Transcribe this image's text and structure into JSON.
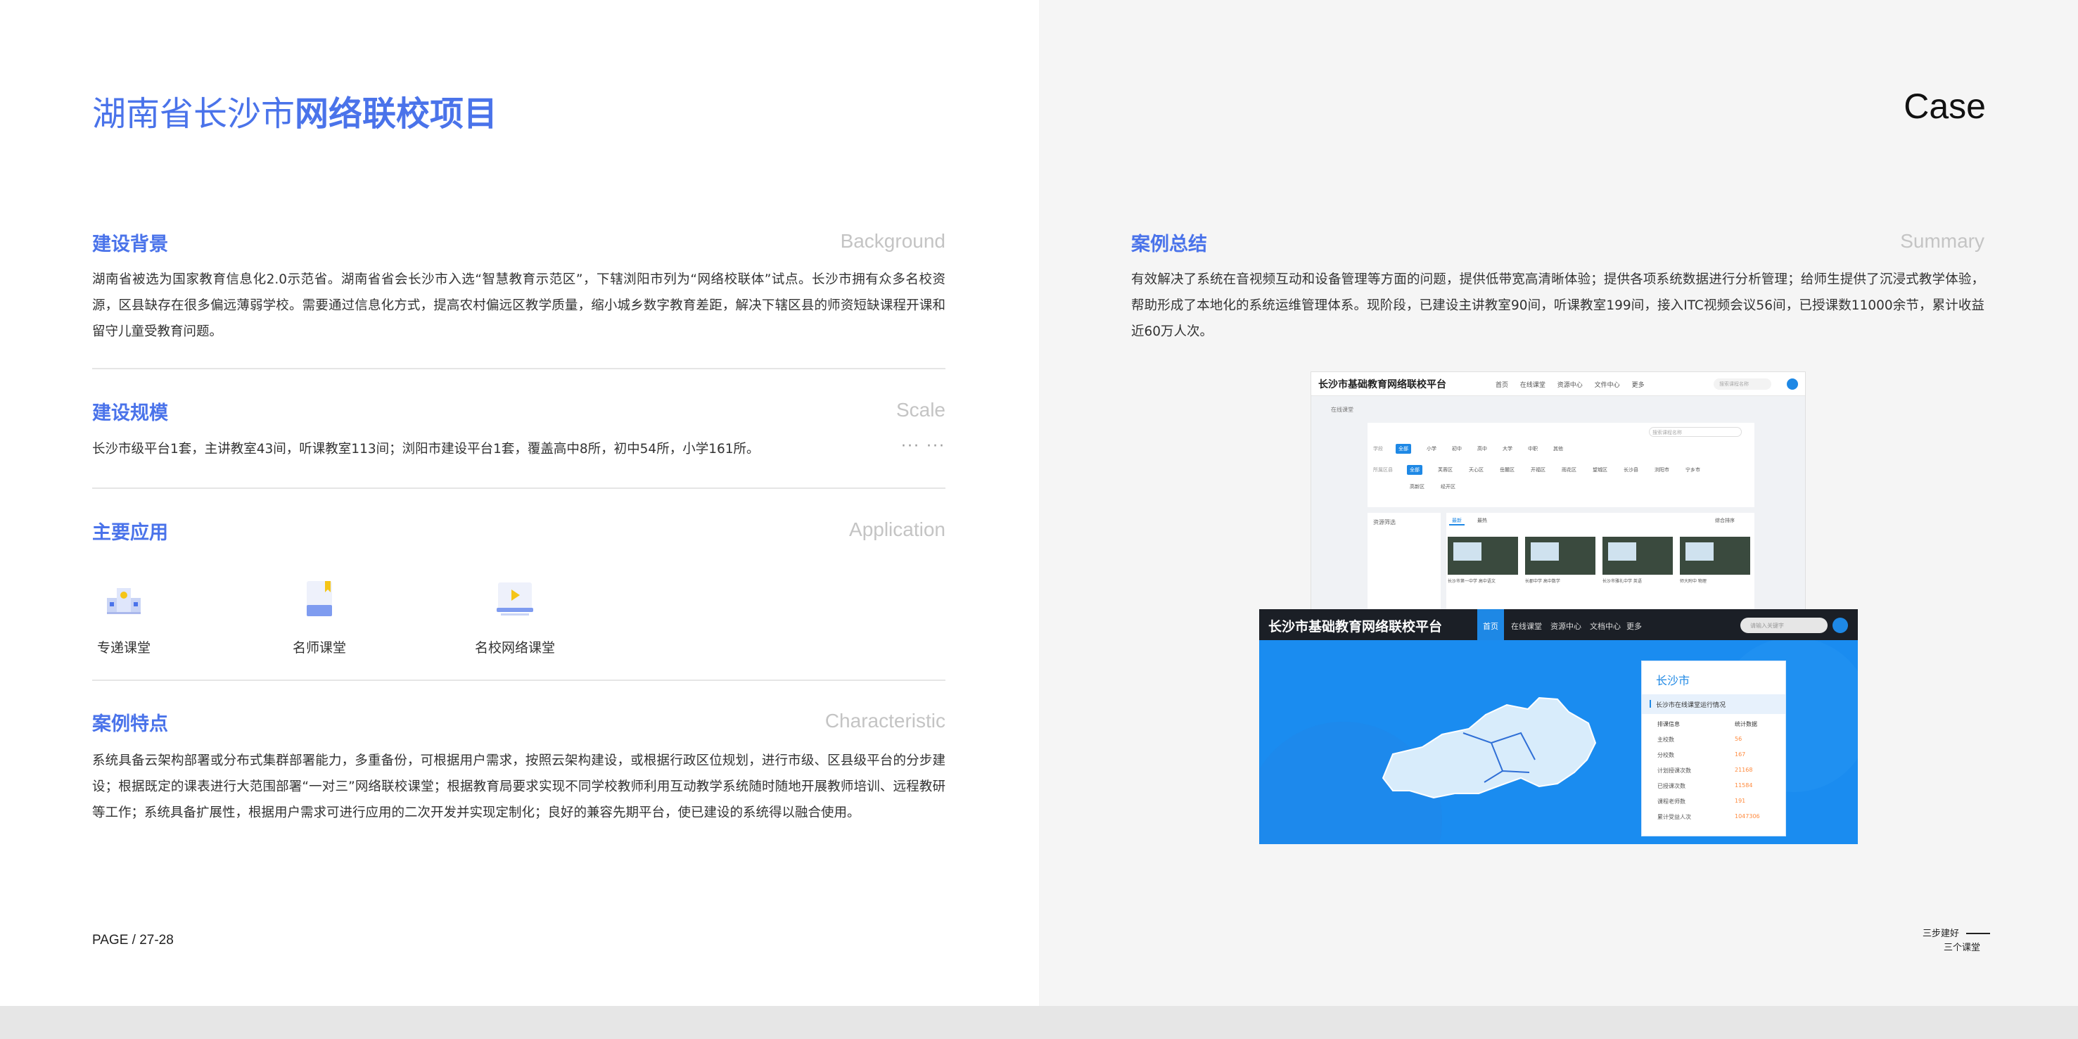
{
  "header": {
    "title_light": "湖南省长沙市",
    "title_bold": "网络联校项目",
    "case_label": "Case"
  },
  "sections": {
    "background": {
      "zh": "建设背景",
      "en": "Background",
      "text": "湖南省被选为国家教育信息化2.0示范省。湖南省省会长沙市入选“智慧教育示范区”，下辖浏阳市列为“网络校联体”试点。长沙市拥有众多名校资源，区县缺存在很多偏远薄弱学校。需要通过信息化方式，提高农村偏远区教学质量，缩小城乡数字教育差距，解决下辖区县的师资短缺课程开课和留守儿童受教育问题。"
    },
    "scale": {
      "zh": "建设规模",
      "en": "Scale",
      "text": "长沙市级平台1套，主讲教室43间，听课教室113间；浏阳市建设平台1套，覆盖高中8所，初中54所，小学161所。",
      "more": "··· ···"
    },
    "application": {
      "zh": "主要应用",
      "en": "Application",
      "items": [
        {
          "label": "专递课堂",
          "icon": "building-icon"
        },
        {
          "label": "名师课堂",
          "icon": "bookmark-icon"
        },
        {
          "label": "名校网络课堂",
          "icon": "video-play-icon"
        }
      ]
    },
    "characteristic": {
      "zh": "案例特点",
      "en": "Characteristic",
      "text": "系统具备云架构部署或分布式集群部署能力，多重备份，可根据用户需求，按照云架构建设，或根据行政区位规划，进行市级、区县级平台的分步建设；根据既定的课表进行大范围部署“一对三”网络联校课堂；根据教育局要求实现不同学校教师利用互动教学系统随时随地开展教师培训、远程教研等工作；系统具备扩展性，根据用户需求可进行应用的二次开发并实现定制化；良好的兼容先期平台，使已建设的系统得以融合使用。"
    },
    "summary": {
      "zh": "案例总结",
      "en": "Summary",
      "text": "有效解决了系统在音视频互动和设备管理等方面的问题，提供低带宽高清晰体验；提供各项系统数据进行分析管理；给师生提供了沉浸式教学体验，帮助形成了本地化的系统运维管理体系。现阶段，已建设主讲教室90间，听课教室199间，接入ITC视频会议56间，已授课数11000余节，累计收益近60万人次。"
    }
  },
  "screenshot1": {
    "title": "长沙市基础教育网络联校平台",
    "nav": [
      "首页",
      "在线课堂",
      "资源中心",
      "文件中心",
      "更多"
    ],
    "search_placeholder": "搜索课程名称",
    "breadcrumb": "在线课堂",
    "filter_search": "搜索课程名称",
    "left_label": "资源筛选",
    "tabs": [
      "最新",
      "最热"
    ],
    "sort": "综合排序",
    "row1_label": "学段",
    "row1": [
      "全部",
      "小学",
      "初中",
      "高中",
      "大学",
      "中职",
      "其他"
    ],
    "row2_label": "所属区县",
    "row2": [
      "全部",
      "芙蓉区",
      "天心区",
      "岳麓区",
      "开福区",
      "雨花区",
      "望城区",
      "长沙县",
      "浏阳市",
      "宁乡市",
      "高新区",
      "经开区"
    ],
    "thumbs": [
      "长沙市第一中学 高中语文",
      "长郡中学 高中数学",
      "长沙市雅礼中学 英语",
      "师大附中 物理"
    ]
  },
  "screenshot2": {
    "title": "长沙市基础教育网络联校平台",
    "tabs": [
      "首页",
      "在线课堂",
      "资源中心",
      "文档中心",
      "更多"
    ],
    "search_placeholder": "请输入关键字",
    "city": "长沙市",
    "subtitle": "长沙市在线课堂运行情况",
    "col_left": "排课信息",
    "col_right": "统计数据",
    "rows": [
      {
        "k": "主校数",
        "v": "56"
      },
      {
        "k": "分校数",
        "v": "167"
      },
      {
        "k": "计划授课次数",
        "v": "21168"
      },
      {
        "k": "已授课次数",
        "v": "11584"
      },
      {
        "k": "课程老师数",
        "v": "191"
      },
      {
        "k": "累计受益人次",
        "v": "1047306"
      }
    ]
  },
  "footer": {
    "page": "PAGE / 27-28",
    "brand_line1": "三步建好",
    "brand_line2": "三个课堂"
  }
}
